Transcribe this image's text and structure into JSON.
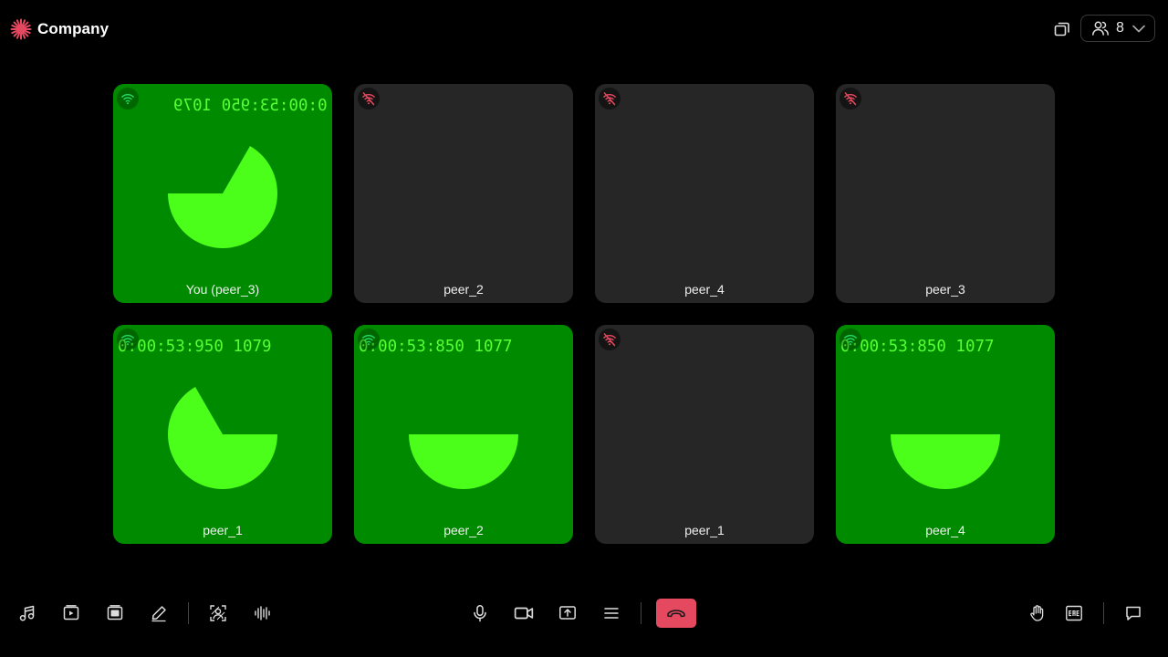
{
  "header": {
    "brand_name": "Company",
    "participant_count": "8"
  },
  "colors": {
    "accent": "#e5495f",
    "tile_video_bg": "#008a00",
    "tile_empty_bg": "#262626",
    "pie_fill": "#4cff1a",
    "network_good": "#27d96a",
    "network_bad": "#e5495f"
  },
  "tiles": [
    {
      "name": "You (peer_3)",
      "video": true,
      "network": "good",
      "timecode": "0:00:53:950 1079",
      "mirrored": true,
      "pie_empty_sector": "top-left-wedge"
    },
    {
      "name": "peer_2",
      "video": false,
      "network": "bad"
    },
    {
      "name": "peer_4",
      "video": false,
      "network": "bad"
    },
    {
      "name": "peer_3",
      "video": false,
      "network": "bad"
    },
    {
      "name": "peer_1",
      "video": true,
      "network": "good",
      "timecode": "0:00:53:950 1079",
      "mirrored": false,
      "pie_empty_sector": "top-right-wedge"
    },
    {
      "name": "peer_2",
      "video": true,
      "network": "good",
      "timecode": "0:00:53:850 1077",
      "mirrored": false,
      "pie_empty_sector": "top-half"
    },
    {
      "name": "peer_1",
      "video": false,
      "network": "bad"
    },
    {
      "name": "peer_4",
      "video": true,
      "network": "good",
      "timecode": "0:00:53:850 1077",
      "mirrored": false,
      "pie_empty_sector": "top-half"
    }
  ],
  "toolbar": {
    "left": [
      "music-icon",
      "video-playlist-icon",
      "image-playlist-icon",
      "pencil-icon",
      "virtual-background-icon",
      "noise-suppression-icon"
    ],
    "center": [
      "microphone-icon",
      "camera-icon",
      "screen-share-icon",
      "more-menu-icon",
      "leave-call-icon"
    ],
    "right": [
      "raise-hand-icon",
      "brb-icon",
      "chat-icon"
    ]
  }
}
